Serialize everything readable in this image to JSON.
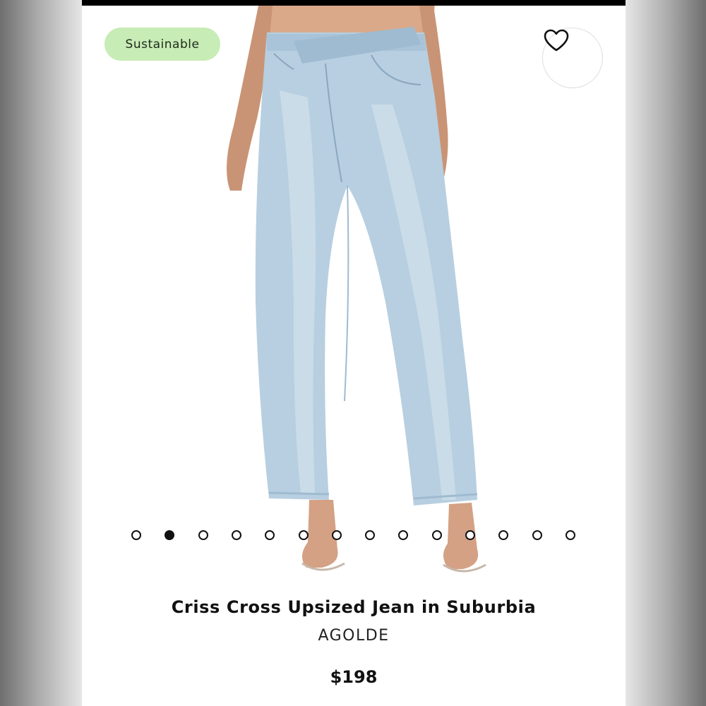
{
  "product": {
    "badge": "Sustainable",
    "title": "Criss Cross Upsized Jean in Suburbia",
    "brand": "AGOLDE",
    "price": "$198"
  },
  "gallery": {
    "image_count": 14,
    "active_index": 1
  },
  "icons": {
    "wishlist": "heart-icon"
  },
  "colors": {
    "badge_bg": "#c7ecb6",
    "denim": "#b7cfe0",
    "text": "#111111"
  }
}
